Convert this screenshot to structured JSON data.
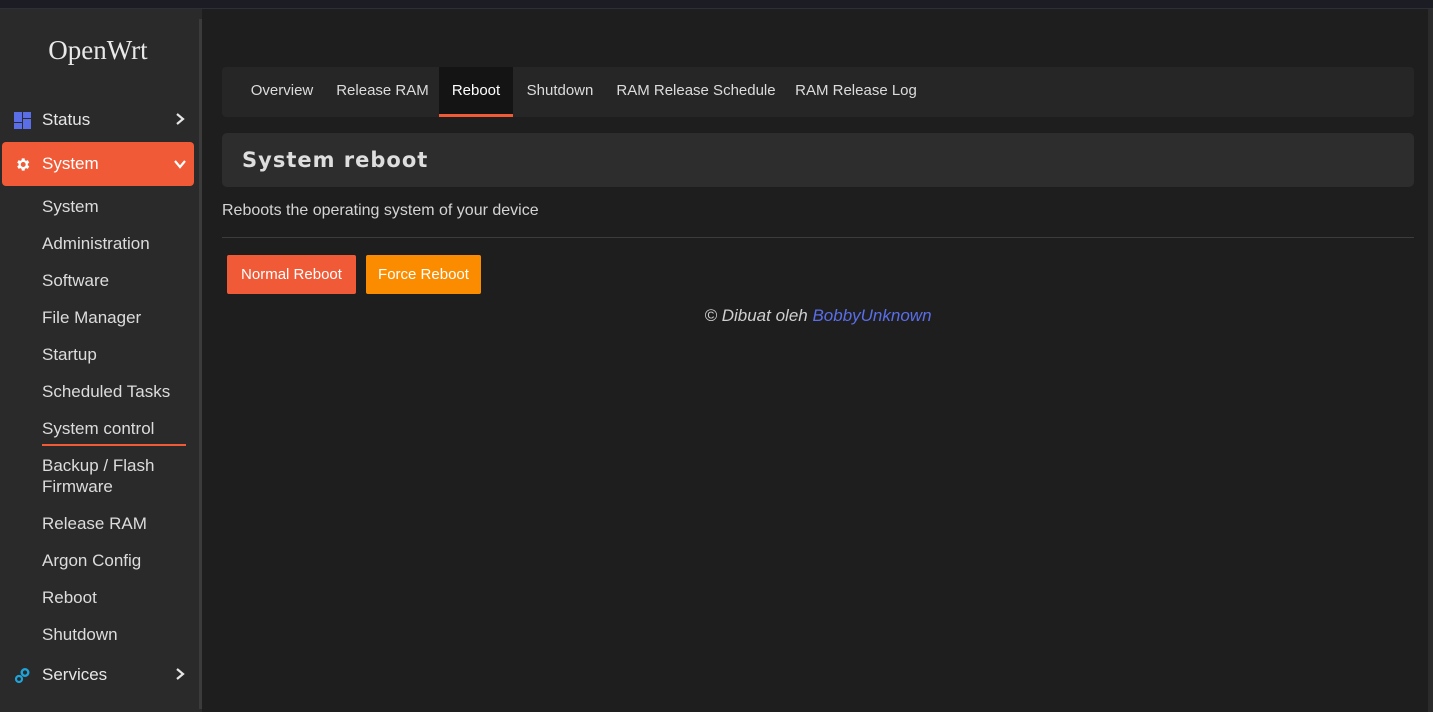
{
  "brand": "OpenWrt",
  "colors": {
    "accent": "#f15a36",
    "warning": "#fb8c00",
    "link": "#5a6ee8",
    "status_icon": "#5a6ee8",
    "services_icon": "#1fa3d8"
  },
  "sidebar": {
    "status": {
      "label": "Status",
      "icon": "dashboard-icon"
    },
    "system": {
      "label": "System",
      "icon": "gear-icon"
    },
    "system_items": [
      "System",
      "Administration",
      "Software",
      "File Manager",
      "Startup",
      "Scheduled Tasks",
      "System control",
      "Backup / Flash",
      "Firmware",
      "Release RAM",
      "Argon Config",
      "Reboot",
      "Shutdown"
    ],
    "services": {
      "label": "Services",
      "icon": "cogs-icon"
    }
  },
  "tabs": [
    "Overview",
    "Release RAM",
    "Reboot",
    "Shutdown",
    "RAM Release Schedule",
    "RAM Release Log"
  ],
  "active_tab": "Reboot",
  "section": {
    "title": "System reboot",
    "description": "Reboots the operating system of your device"
  },
  "buttons": {
    "normal": "Normal Reboot",
    "force": "Force Reboot"
  },
  "footer": {
    "prefix": "© Dibuat oleh ",
    "author": "BobbyUnknown"
  }
}
